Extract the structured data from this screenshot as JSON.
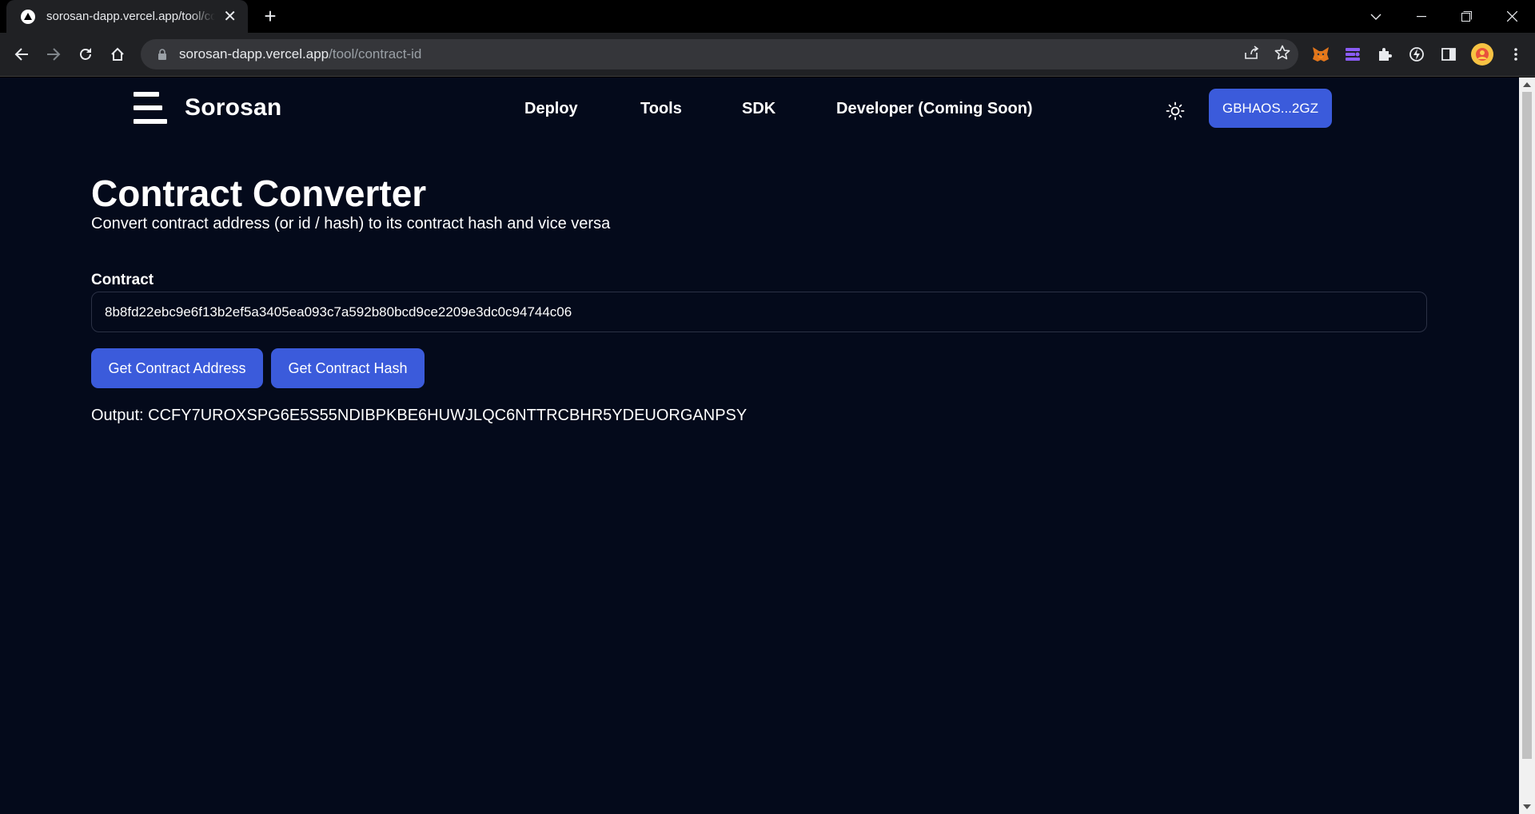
{
  "browser": {
    "tab_title": "sorosan-dapp.vercel.app/tool/contract-id",
    "url_host": "sorosan-dapp.vercel.app",
    "url_path": "/tool/contract-id"
  },
  "header": {
    "logo_text": "Sorosan",
    "nav": [
      {
        "label": "Deploy"
      },
      {
        "label": "Tools"
      },
      {
        "label": "SDK"
      },
      {
        "label": "Developer (Coming Soon)"
      }
    ],
    "wallet_label": "GBHAOS...2GZ"
  },
  "main": {
    "title": "Contract Converter",
    "subtitle": "Convert contract address (or id / hash) to its contract hash and vice versa",
    "contract_label": "Contract",
    "contract_value": "8b8fd22ebc9e6f13b2ef5a3405ea093c7a592b80bcd9ce2209e3dc0c94744c06",
    "btn_address": "Get Contract Address",
    "btn_hash": "Get Contract Hash",
    "output_text": "Output: CCFY7UROXSPG6E5S55NDIBPKBE6HUWJLQC6NTTRCBHR5YDEUORGANPSY"
  },
  "colors": {
    "page_bg": "#040a1b",
    "accent": "#3b5bdb"
  }
}
